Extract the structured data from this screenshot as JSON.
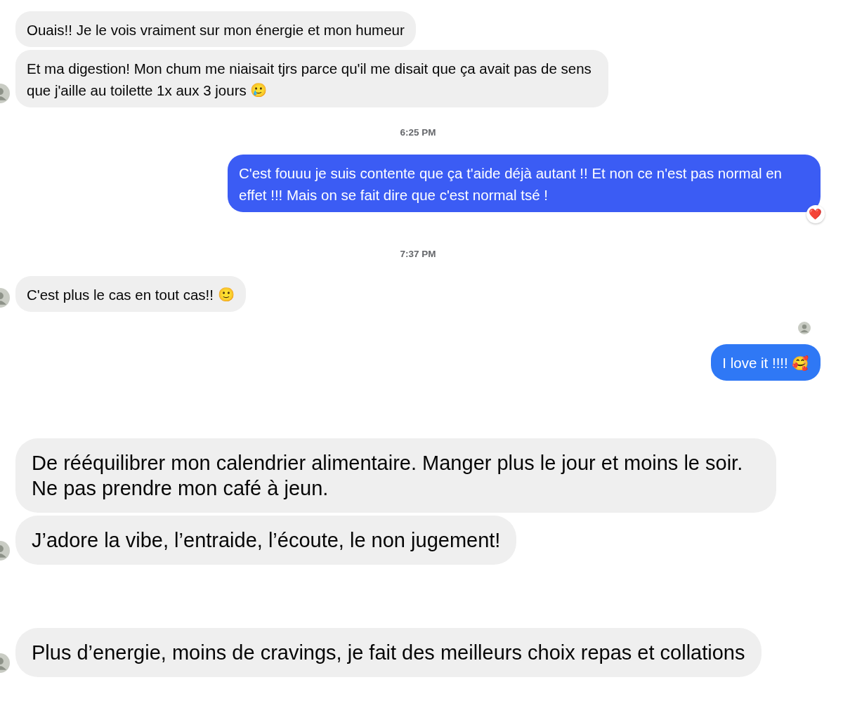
{
  "sections": [
    {
      "kind": "thread",
      "items": [
        {
          "kind": "received",
          "text": "Ouais!! Je le vois vraiment sur mon énergie et mon humeur",
          "avatar": false
        },
        {
          "kind": "received",
          "text": "Et ma digestion! Mon chum me niaisait tjrs parce qu'il me disait que ça avait pas de sens que j'aille au toilette 1x aux 3 jours",
          "emoji": "🥲",
          "avatar": true
        },
        {
          "kind": "timestamp",
          "text": "6:25 PM"
        },
        {
          "kind": "sent",
          "text": "C'est fouuu je suis contente que ça t'aide déjà autant !! Et non ce n'est pas normal en effet !!! Mais on se fait dire que c'est normal tsé !",
          "color": "#3b5cf4",
          "reaction": "❤️"
        },
        {
          "kind": "timestamp",
          "text": "7:37 PM"
        },
        {
          "kind": "received",
          "text": "C'est plus le cas en tout cas!!",
          "emoji": "🙂",
          "avatar": true
        },
        {
          "kind": "seen"
        },
        {
          "kind": "sent",
          "text": "I love it !!!!",
          "emoji": "🥰",
          "color": "#2f78f5"
        }
      ]
    },
    {
      "kind": "excerpt",
      "items": [
        {
          "kind": "received",
          "text": "De rééquilibrer mon calendrier alimentaire. Manger plus le jour et moins le soir. Ne pas prendre mon café à jeun.",
          "avatar": false
        },
        {
          "kind": "received",
          "text": "J’adore la vibe, l’entraide, l’écoute, le non jugement!",
          "avatar": true
        }
      ]
    },
    {
      "kind": "excerpt",
      "items": [
        {
          "kind": "received",
          "text": "Plus d’energie, moins de cravings, je fait des meilleurs choix repas et collations",
          "avatar": true
        }
      ]
    }
  ]
}
